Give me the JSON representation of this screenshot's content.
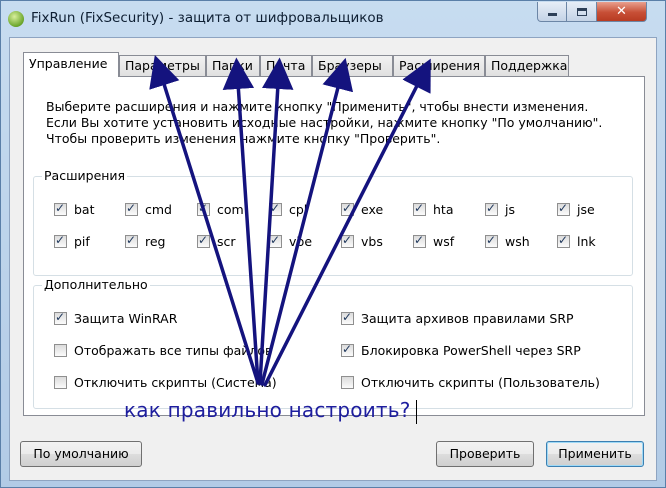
{
  "window": {
    "title": "FixRun (FixSecurity) - защита от шифровальщиков",
    "controls": [
      "minimize",
      "maximize",
      "close"
    ]
  },
  "tabs": [
    {
      "label": "Управление",
      "active": true
    },
    {
      "label": "Параметры",
      "active": false
    },
    {
      "label": "Папки",
      "active": false
    },
    {
      "label": "Почта",
      "active": false
    },
    {
      "label": "Браузеры",
      "active": false
    },
    {
      "label": "Расширения",
      "active": false
    },
    {
      "label": "Поддержка",
      "active": false
    }
  ],
  "intro": {
    "line1": "Выберите расширения и нажмите кнопку \"Применить\", чтобы внести изменения.",
    "line2": "Если Вы хотите установить исходные настройки, нажмите кнопку \"По умолчанию\".",
    "line3": "Чтобы проверить изменения нажмите кнопку \"Проверить\"."
  },
  "extensions": {
    "label": "Расширения",
    "items": [
      {
        "label": "bat",
        "checked": true
      },
      {
        "label": "cmd",
        "checked": true
      },
      {
        "label": "com",
        "checked": true
      },
      {
        "label": "cpl",
        "checked": true
      },
      {
        "label": "exe",
        "checked": true
      },
      {
        "label": "hta",
        "checked": true
      },
      {
        "label": "js",
        "checked": true
      },
      {
        "label": "jse",
        "checked": true
      },
      {
        "label": "pif",
        "checked": true
      },
      {
        "label": "reg",
        "checked": true
      },
      {
        "label": "scr",
        "checked": true
      },
      {
        "label": "vbe",
        "checked": true
      },
      {
        "label": "vbs",
        "checked": true
      },
      {
        "label": "wsf",
        "checked": true
      },
      {
        "label": "wsh",
        "checked": true
      },
      {
        "label": "lnk",
        "checked": true
      }
    ]
  },
  "additional": {
    "label": "Дополнительно",
    "items": [
      {
        "label": "Защита WinRAR",
        "checked": true
      },
      {
        "label": "Защита архивов правилами SRP",
        "checked": true
      },
      {
        "label": "Отображать все типы файлов",
        "checked": false
      },
      {
        "label": "Блокировка PowerShell через SRP",
        "checked": true
      },
      {
        "label": "Отключить скрипты (Система)",
        "checked": false
      },
      {
        "label": "Отключить скрипты (Пользователь)",
        "checked": false
      }
    ]
  },
  "buttons": {
    "defaults": "По умолчанию",
    "check": "Проверить",
    "apply": "Применить"
  },
  "overlay": {
    "text": "как правильно настроить?",
    "color": "#1e1e9e"
  }
}
